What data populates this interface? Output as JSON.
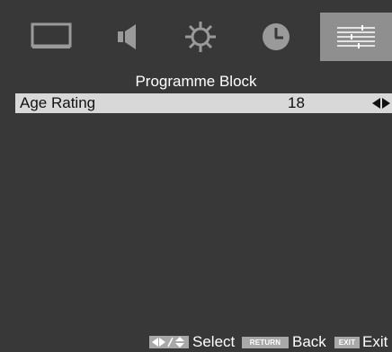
{
  "tabs": [
    {
      "name": "picture",
      "icon": "monitor-icon",
      "selected": false
    },
    {
      "name": "sound",
      "icon": "speaker-icon",
      "selected": false
    },
    {
      "name": "setup",
      "icon": "gear-icon",
      "selected": false
    },
    {
      "name": "timer",
      "icon": "clock-icon",
      "selected": false
    },
    {
      "name": "options",
      "icon": "sliders-icon",
      "selected": true
    }
  ],
  "menu": {
    "title": "Programme Block",
    "rows": [
      {
        "label": "Age Rating",
        "value": "18",
        "selected": true
      }
    ]
  },
  "footer": {
    "select_label": "Select",
    "return_key": "RETURN",
    "back_label": "Back",
    "exit_key": "EXIT",
    "exit_label": "Exit"
  },
  "colors": {
    "background": "#383838",
    "selected_tab": "#8f8f8f",
    "icon_idle": "#9a9a9a",
    "row_highlight": "#d8d8d8",
    "key_badge": "#a8a8a8"
  }
}
